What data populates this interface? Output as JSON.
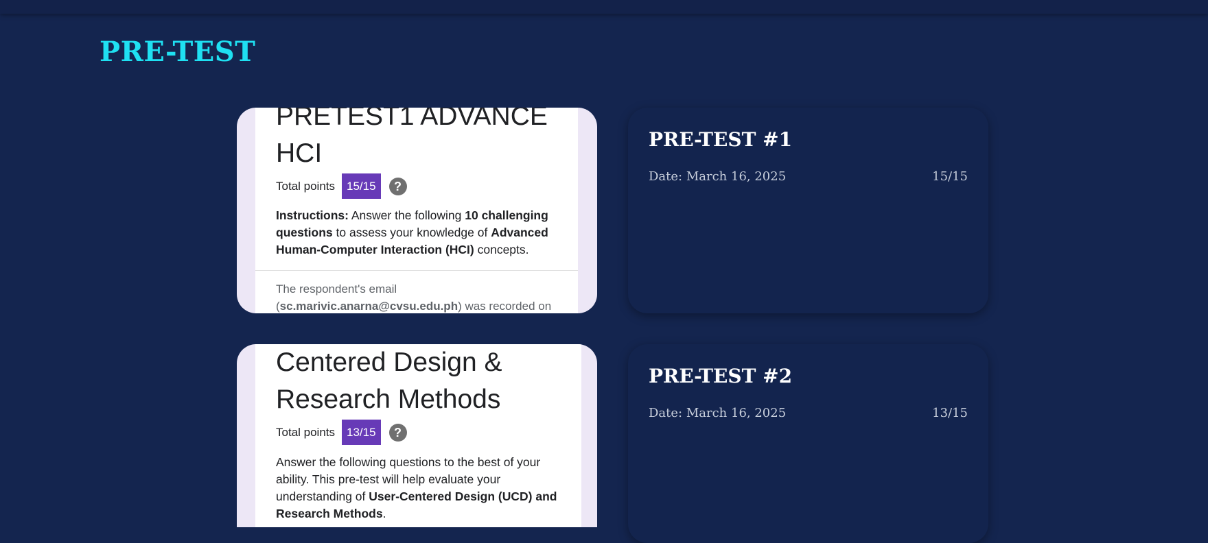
{
  "header": {
    "title": "PRE-TEST"
  },
  "entries": [
    {
      "form": {
        "title": "PRETEST1 ADVANCE HCI",
        "points_label": "Total points",
        "score": "15/15",
        "help_icon": "?",
        "desc_parts": [
          "Instructions:",
          " Answer the following ",
          "10 challenging questions",
          " to assess your knowledge of ",
          "Advanced Human-Computer Interaction (HCI)",
          " concepts."
        ],
        "email_parts": [
          "The respondent's email (",
          "sc.marivic.anarna@cvsu.edu.ph",
          ") was recorded on"
        ]
      },
      "card": {
        "title": "PRE-TEST #1",
        "date": "Date: March 16, 2025",
        "score": "15/15"
      }
    },
    {
      "form": {
        "title": "Centered Design & Research Methods",
        "points_label": "Total points",
        "score": "13/15",
        "help_icon": "?",
        "desc_parts": [
          " Answer the following questions to the best of your ability. This pre-test will help evaluate your understanding of ",
          "User-Centered Design (UCD) and Research Methods",
          "."
        ]
      },
      "card": {
        "title": "PRE-TEST #2",
        "date": "Date: March 16, 2025",
        "score": "13/15"
      }
    }
  ],
  "colors": {
    "background": "#14254f",
    "title_accent": "#1fe0f2",
    "score_chip": "#673ab7",
    "form_border": "#ede7f6"
  }
}
